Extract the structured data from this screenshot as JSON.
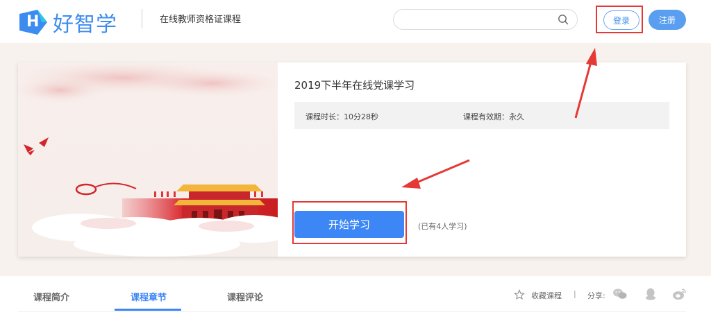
{
  "header": {
    "logo_text": "好智学",
    "logo_letter": "H",
    "site_subtitle": "在线教师资格证课程",
    "search": {
      "placeholder": ""
    },
    "login_label": "登录",
    "register_label": "注册"
  },
  "course": {
    "title": "2019下半年在线党课学习",
    "duration_text": "课程时长：10分28秒",
    "validity_text": "课程有效期：永久",
    "start_button_label": "开始学习",
    "learner_count_text": "(已有4人学习)"
  },
  "tabs": [
    {
      "label": "课程简介",
      "active": false
    },
    {
      "label": "课程章节",
      "active": true
    },
    {
      "label": "课程评论",
      "active": false
    }
  ],
  "actions": {
    "favorite_label": "收藏课程",
    "separator": "|",
    "share_label": "分享:",
    "share_icons": [
      "wechat-icon",
      "qq-icon",
      "weibo-icon"
    ]
  },
  "colors": {
    "brand_blue": "#3c86f5",
    "annotation_red": "#e53935",
    "hero_background": "#f7f2ee"
  }
}
